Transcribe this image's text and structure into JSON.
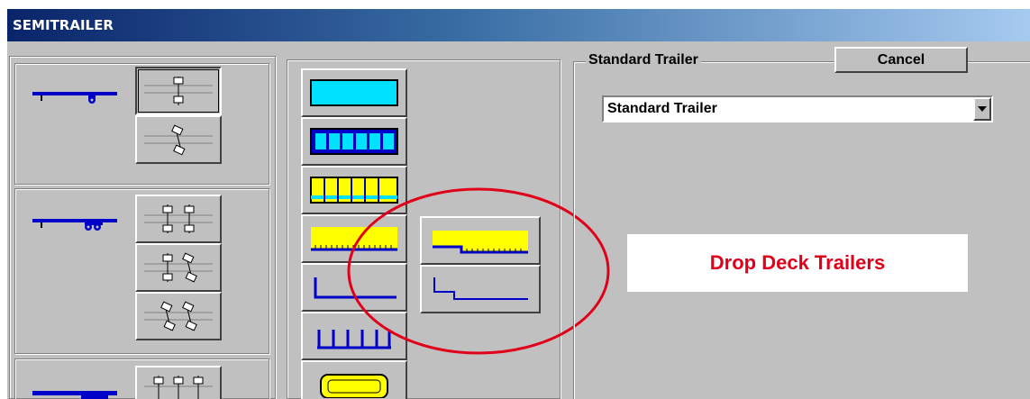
{
  "window": {
    "title": "SEMITRAILER"
  },
  "type_panel": {
    "group_label": "Standard Trailer",
    "cancel_label": "Cancel",
    "selected_type": "Standard Trailer"
  },
  "annotation": {
    "text": "Drop Deck Trailers",
    "color": "#e0001a"
  },
  "colors": {
    "trailer_blue": "#0000c8",
    "deck_cyan": "#00e0ff",
    "deck_yellow": "#ffff00",
    "face": "#c0c0c0"
  }
}
